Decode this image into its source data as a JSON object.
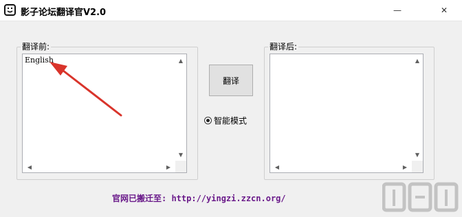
{
  "window": {
    "title": "影子论坛翻译官V2.0",
    "minimize_glyph": "—",
    "close_glyph": "✕"
  },
  "source_panel": {
    "label": "翻译前:",
    "text": "English"
  },
  "target_panel": {
    "label": "翻译后:",
    "text": ""
  },
  "translate_button": {
    "label": "翻译"
  },
  "mode": {
    "label": "智能模式",
    "selected": true
  },
  "footer": {
    "text": "官网已搬迁至: http://yingzi.zzcn.org/"
  },
  "icons": {
    "app": "smiley-face-icon",
    "annotation": "red-arrow-annotation",
    "watermark": "site-logo-watermark"
  },
  "colors": {
    "annotation_arrow": "#d9342b",
    "footer_text": "#6a1a8a"
  }
}
